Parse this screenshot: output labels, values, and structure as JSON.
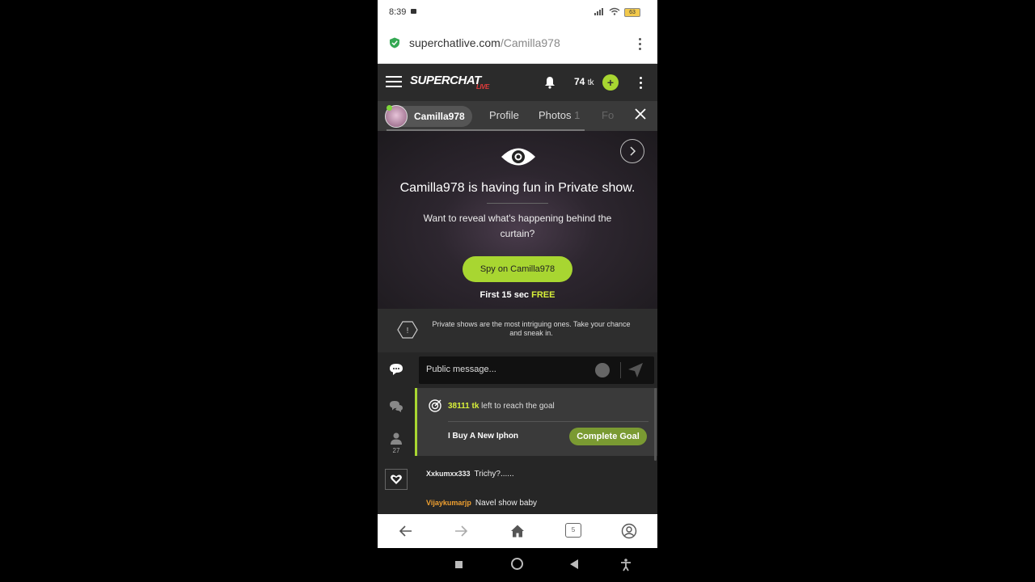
{
  "status_bar": {
    "time": "8:39",
    "battery": "63"
  },
  "browser": {
    "url_host": "superchatlive.com",
    "url_path": "/Camilla978"
  },
  "site_header": {
    "logo": "SUPERCHAT",
    "logo_sub": "LIVE",
    "token_count": "74",
    "token_unit": "tk",
    "plus": "+"
  },
  "profile_tabs": {
    "username": "Camilla978",
    "tabs": [
      {
        "label": "Profile"
      },
      {
        "label": "Photos",
        "count": "1"
      },
      {
        "label": "Fo"
      }
    ]
  },
  "private_show": {
    "title": "Camilla978 is having fun in Private show.",
    "subtitle": "Want to reveal what's happening behind the curtain?",
    "spy_button": "Spy on Camilla978",
    "free_prefix": "First 15 sec",
    "free_label": "FREE"
  },
  "info_strip": {
    "icon_glyph": "!",
    "text": "Private shows are the most intriguing ones. Take your chance and sneak in."
  },
  "chat": {
    "input_placeholder": "Public message...",
    "sidebar_user_count": "27",
    "goal": {
      "amount": "38111 tk",
      "text": "left to reach the goal",
      "name": "I Buy A New Iphon",
      "button": "Complete Goal"
    },
    "messages": [
      {
        "user": "Xxkumxx333",
        "text": "Trichy?......",
        "color": "#dddddd"
      },
      {
        "user": "Vijaykumarjp",
        "text": "Navel show baby",
        "color": "#f0a030"
      }
    ]
  },
  "bottom_nav": {
    "tabs_count": "5"
  },
  "colors": {
    "accent_green": "#a8d631",
    "free_yellow": "#d8f03a",
    "dark_bg": "#262626"
  }
}
